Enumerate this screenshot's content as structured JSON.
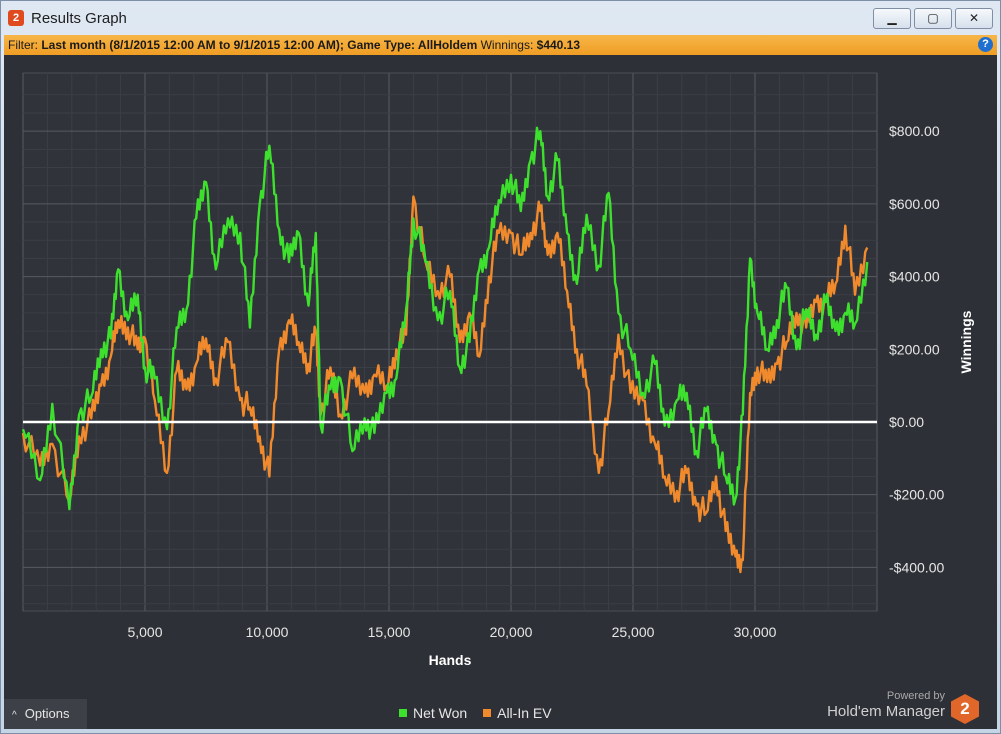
{
  "window": {
    "title": "Results Graph",
    "app_icon_text": "2",
    "buttons": {
      "minimize": "▁",
      "maximize": "▢",
      "close": "✕"
    }
  },
  "filter": {
    "prefix": "Filter:",
    "text": "Last month (8/1/2015 12:00 AM to 9/1/2015 12:00 AM); Game Type: AllHoldem",
    "winnings_label": "Winnings:",
    "winnings_value": "$440.13",
    "help_icon_text": "?"
  },
  "options": {
    "label": "Options",
    "chevron": "^"
  },
  "legend": [
    {
      "label": "Net Won",
      "color": "#3ee02e"
    },
    {
      "label": "All-In EV",
      "color": "#f08a2c"
    }
  ],
  "branding": {
    "powered_by": "Powered by",
    "name": "Hold'em Manager",
    "logo_text": "2"
  },
  "chart_data": {
    "type": "line",
    "xlabel": "Hands",
    "ylabel": "Winnings",
    "xlim": [
      0,
      35000
    ],
    "ylim": [
      -520,
      960
    ],
    "x_ticks": [
      5000,
      10000,
      15000,
      20000,
      25000,
      30000
    ],
    "x_tick_labels": [
      "5,000",
      "10,000",
      "15,000",
      "20,000",
      "25,000",
      "30,000"
    ],
    "y_ticks": [
      800,
      600,
      400,
      200,
      0,
      -200,
      -400
    ],
    "y_tick_labels": [
      "$800.00",
      "$600.00",
      "$400.00",
      "$200.00",
      "$0.00",
      "-$200.00",
      "-$400.00"
    ],
    "zero_line": true,
    "grid": true,
    "legend_position": "bottom",
    "series": [
      {
        "name": "Net Won",
        "color": "#3ee02e",
        "x": [
          0,
          700,
          1200,
          1900,
          2300,
          2800,
          3200,
          3600,
          3900,
          4300,
          4700,
          5000,
          5400,
          5900,
          6300,
          6700,
          7100,
          7500,
          7900,
          8400,
          8900,
          9300,
          9700,
          10100,
          10500,
          10900,
          11300,
          11700,
          12000,
          12200,
          12600,
          13000,
          13500,
          14000,
          14400,
          14900,
          15300,
          15700,
          16000,
          16500,
          17000,
          17500,
          17900,
          18300,
          18700,
          19100,
          19500,
          20000,
          20400,
          20800,
          21200,
          21500,
          21900,
          22300,
          22700,
          23100,
          23600,
          24000,
          24400,
          24900,
          25400,
          25900,
          26300,
          26800,
          27200,
          27600,
          28000,
          28400,
          28800,
          29200,
          29500,
          29800,
          30100,
          30500,
          30900,
          31300,
          31700,
          32100,
          32500,
          32900,
          33300,
          33700,
          34100,
          34600
        ],
        "values": [
          -20,
          -160,
          50,
          -240,
          20,
          70,
          200,
          230,
          420,
          280,
          350,
          150,
          120,
          -20,
          260,
          310,
          560,
          660,
          420,
          560,
          520,
          260,
          600,
          760,
          530,
          440,
          520,
          320,
          520,
          -10,
          90,
          120,
          -80,
          10,
          -30,
          80,
          120,
          310,
          560,
          440,
          280,
          360,
          150,
          220,
          420,
          480,
          610,
          680,
          580,
          720,
          800,
          620,
          720,
          520,
          380,
          570,
          430,
          630,
          300,
          200,
          80,
          160,
          -10,
          60,
          80,
          -80,
          30,
          -60,
          -150,
          -210,
          20,
          450,
          300,
          200,
          280,
          370,
          200,
          310,
          240,
          330,
          250,
          300,
          270,
          440
        ]
      },
      {
        "name": "All-In EV",
        "color": "#f08a2c",
        "x": [
          0,
          700,
          1200,
          1900,
          2300,
          2800,
          3200,
          3600,
          3900,
          4300,
          4700,
          5000,
          5400,
          5900,
          6300,
          6700,
          7100,
          7500,
          7900,
          8400,
          8900,
          9300,
          9700,
          10100,
          10500,
          10900,
          11300,
          11700,
          12000,
          12200,
          12600,
          13000,
          13500,
          14000,
          14400,
          14900,
          15300,
          15700,
          16000,
          16500,
          17000,
          17500,
          17900,
          18300,
          18700,
          19100,
          19500,
          20000,
          20400,
          20800,
          21200,
          21500,
          21900,
          22300,
          22700,
          23100,
          23600,
          24000,
          24400,
          24900,
          25400,
          25900,
          26300,
          26800,
          27200,
          27600,
          28000,
          28400,
          28800,
          29200,
          29500,
          29800,
          30100,
          30500,
          30900,
          31300,
          31700,
          32100,
          32500,
          32900,
          33300,
          33700,
          34100,
          34600
        ],
        "values": [
          -30,
          -120,
          -60,
          -220,
          -40,
          10,
          100,
          180,
          280,
          260,
          200,
          230,
          60,
          -140,
          140,
          90,
          160,
          230,
          120,
          220,
          60,
          40,
          -40,
          -150,
          200,
          280,
          220,
          160,
          250,
          20,
          150,
          20,
          120,
          80,
          130,
          100,
          200,
          240,
          620,
          440,
          360,
          400,
          220,
          300,
          180,
          400,
          520,
          520,
          460,
          520,
          580,
          460,
          520,
          360,
          200,
          100,
          -140,
          30,
          240,
          80,
          60,
          -60,
          -150,
          -190,
          -140,
          -230,
          -250,
          -150,
          -300,
          -370,
          -380,
          80,
          150,
          110,
          160,
          220,
          300,
          260,
          330,
          330,
          380,
          540,
          350,
          480
        ]
      }
    ]
  }
}
